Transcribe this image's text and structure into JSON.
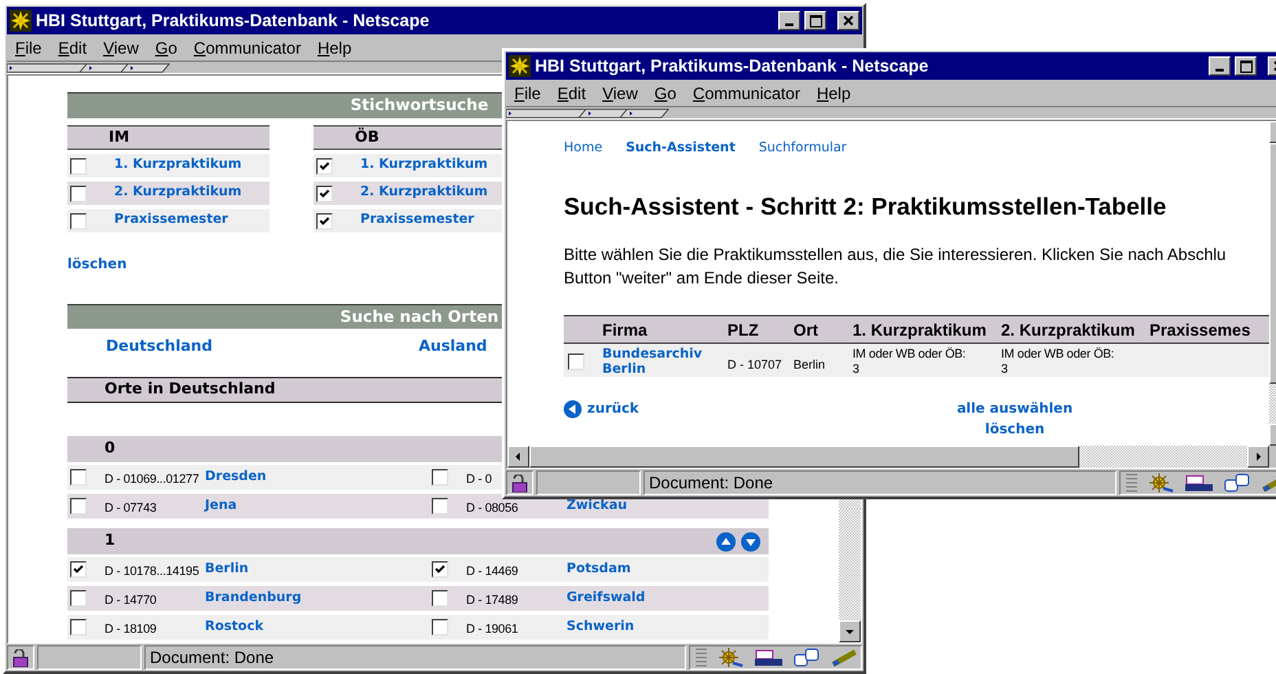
{
  "back_window": {
    "title": "HBI Stuttgart, Praktikums-Datenbank - Netscape",
    "menu": [
      "File",
      "Edit",
      "View",
      "Go",
      "Communicator",
      "Help"
    ],
    "keyword_search": {
      "title": "Stichwortsuche",
      "groups": [
        {
          "heading": "IM",
          "items": [
            {
              "label": "1. Kurzpraktikum",
              "checked": false
            },
            {
              "label": "2. Kurzpraktikum",
              "checked": false
            },
            {
              "label": "Praxissemester",
              "checked": false
            }
          ]
        },
        {
          "heading": "ÖB",
          "items": [
            {
              "label": "1. Kurzpraktikum",
              "checked": true
            },
            {
              "label": "2. Kurzpraktikum",
              "checked": true
            },
            {
              "label": "Praxissemester",
              "checked": true
            }
          ]
        }
      ],
      "clear_link": "löschen"
    },
    "place_search": {
      "title": "Suche nach Orten",
      "links": [
        "Deutschland",
        "Ausland"
      ],
      "subtitle": "Orte in Deutschland",
      "sections": [
        {
          "heading": "0",
          "rows": [
            [
              {
                "plz": "D - 01069...01277",
                "city": "Dresden",
                "checked": false
              },
              {
                "plz": "D - 0",
                "checked": false
              }
            ],
            [
              {
                "plz": "D - 07743",
                "city": "Jena",
                "checked": false
              },
              {
                "plz": "D - 08056",
                "city": "Zwickau",
                "checked": false
              }
            ]
          ]
        },
        {
          "heading": "1",
          "nav_arrows": true,
          "rows": [
            [
              {
                "plz": "D - 10178...14195",
                "city": "Berlin",
                "checked": true
              },
              {
                "plz": "D - 14469",
                "city": "Potsdam",
                "checked": true
              }
            ],
            [
              {
                "plz": "D - 14770",
                "city": "Brandenburg",
                "checked": false
              },
              {
                "plz": "D - 17489",
                "city": "Greifswald",
                "checked": false
              }
            ],
            [
              {
                "plz": "D - 18109",
                "city": "Rostock",
                "checked": false
              },
              {
                "plz": "D - 19061",
                "city": "Schwerin",
                "checked": false
              }
            ]
          ]
        }
      ]
    },
    "status": "Document: Done"
  },
  "front_window": {
    "title": "HBI Stuttgart, Praktikums-Datenbank - Netscape",
    "menu": [
      "File",
      "Edit",
      "View",
      "Go",
      "Communicator",
      "Help"
    ],
    "nav": [
      {
        "label": "Home",
        "selected": false
      },
      {
        "label": "Such-Assistent",
        "selected": true
      },
      {
        "label": "Suchformular",
        "selected": false
      }
    ],
    "heading": "Such-Assistent - Schritt 2: Praktikumsstellen-Tabelle",
    "intro_lines": [
      "Bitte wählen Sie die Praktikumsstellen aus, die Sie interessieren. Klicken Sie nach Abschlu",
      "Button \"weiter\" am Ende dieser Seite."
    ],
    "table": {
      "columns": [
        "Firma",
        "PLZ",
        "Ort",
        "1. Kurzpraktikum",
        "2. Kurzpraktikum",
        "Praxissemes"
      ],
      "rows": [
        {
          "checked": false,
          "firma": "Bundesarchiv Berlin",
          "plz": "D - 10707",
          "ort": "Berlin",
          "kurzpraktikum_1": "IM oder WB oder ÖB: 3",
          "kurzpraktikum_2": "IM oder WB oder ÖB: 3"
        }
      ]
    },
    "back_link": "zurück",
    "select_all_link": "alle auswählen",
    "clear_link": "löschen",
    "status": "Document: Done"
  }
}
